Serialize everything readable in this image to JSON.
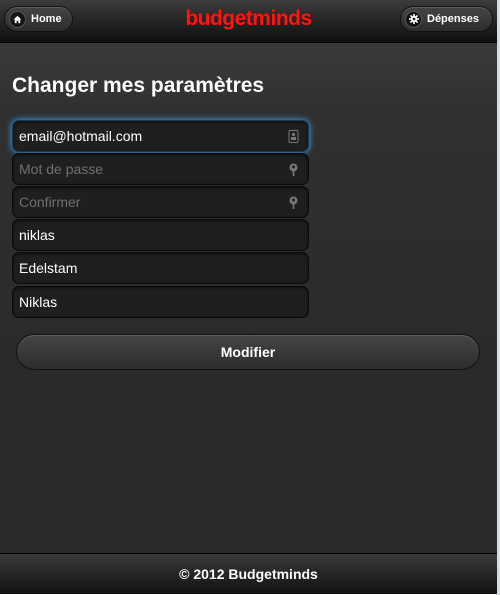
{
  "header": {
    "home_label": "Home",
    "brand": "budgetminds",
    "depenses_label": "Dépenses",
    "icons": {
      "home": "home-icon",
      "depenses": "gear-icon"
    }
  },
  "form": {
    "title": "Changer mes paramètres",
    "fields": [
      {
        "name": "email",
        "value": "email@hotmail.com",
        "placeholder": "",
        "icon": "contact-icon"
      },
      {
        "name": "password",
        "value": "",
        "placeholder": "Mot de passe",
        "icon": "key-icon"
      },
      {
        "name": "confirm",
        "value": "",
        "placeholder": "Confirmer",
        "icon": "key-icon"
      },
      {
        "name": "username",
        "value": "niklas",
        "placeholder": ""
      },
      {
        "name": "lastname",
        "value": "Edelstam",
        "placeholder": ""
      },
      {
        "name": "firstname",
        "value": "Niklas",
        "placeholder": ""
      }
    ],
    "submit_label": "Modifier"
  },
  "footer": {
    "text": "© 2012 Budgetminds"
  },
  "colors": {
    "brand": "#ff1414",
    "focus": "#3a8fd6",
    "background": "#2a2a2a"
  }
}
